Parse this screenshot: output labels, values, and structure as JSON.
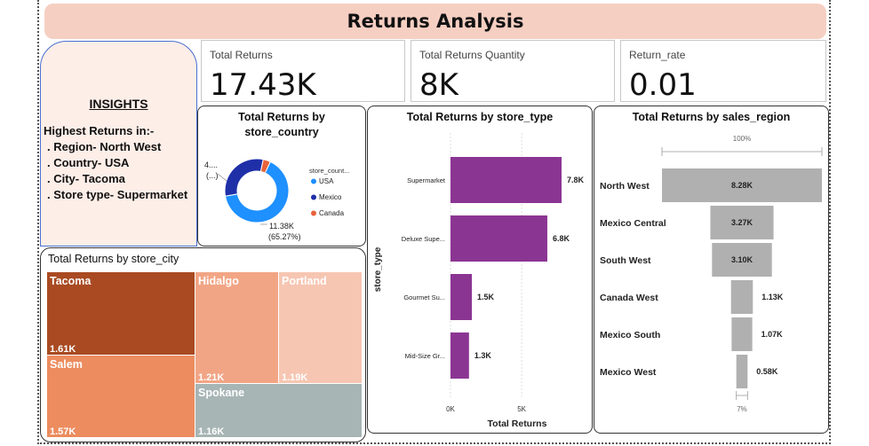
{
  "header": {
    "title": "Returns Analysis"
  },
  "kpis": [
    {
      "label": "Total Returns",
      "value": "17.43K"
    },
    {
      "label": "Total Returns Quantity",
      "value": "8K"
    },
    {
      "label": "Return_rate",
      "value": "0.01"
    }
  ],
  "insights": {
    "title": "INSIGHTS",
    "heading": "Highest Returns in:-",
    "lines": [
      ". Region- North West",
      ". Country- USA",
      ". City- Tacoma",
      ". Store type- Supermarket"
    ]
  },
  "colors": {
    "title_bar": "#f5cfc2",
    "usa": "#1e90ff",
    "mexico": "#1f2fa8",
    "canada": "#e8623a",
    "bar": "#8b3593",
    "funnel": "#b0b0b0"
  },
  "chart_data": [
    {
      "type": "pie",
      "title": "Total Returns by store_country",
      "legend_title": "store_count...",
      "legend_position": "right",
      "categories": [
        "USA",
        "Mexico",
        "Canada"
      ],
      "values": [
        11.38,
        5.4,
        0.65
      ],
      "data_labels": [
        "11.38K (65.27%)",
        "4.... (...)"
      ]
    },
    {
      "type": "heatmap",
      "title": "Total Returns by store_city",
      "categories": [
        "Tacoma",
        "Salem",
        "Hidalgo",
        "Portland",
        "Spokane"
      ],
      "values": [
        1.61,
        1.57,
        1.21,
        1.19,
        1.16
      ],
      "value_labels": [
        "1.61K",
        "1.57K",
        "1.21K",
        "1.19K",
        "1.16K"
      ]
    },
    {
      "type": "bar",
      "orientation": "horizontal",
      "title": "Total Returns by store_type",
      "xlabel": "Total Returns",
      "ylabel": "store_type",
      "categories": [
        "Supermarket",
        "Deluxe Supe...",
        "Gourmet Su...",
        "Mid-Size Gr..."
      ],
      "values": [
        7.8,
        6.8,
        1.5,
        1.3
      ],
      "value_labels": [
        "7.8K",
        "6.8K",
        "1.5K",
        "1.3K"
      ],
      "xlim": [
        0,
        8.4
      ],
      "x_ticks": [
        {
          "value": 0,
          "label": "0K"
        },
        {
          "value": 5,
          "label": "5K"
        }
      ],
      "grid": true
    },
    {
      "type": "bar",
      "subtype": "funnel",
      "title": "Total Returns by sales_region",
      "categories": [
        "North West",
        "Mexico Central",
        "South West",
        "Canada West",
        "Mexico South",
        "Mexico West"
      ],
      "values": [
        8.28,
        3.27,
        3.1,
        1.13,
        1.07,
        0.58
      ],
      "value_labels": [
        "8.28K",
        "3.27K",
        "3.10K",
        "1.13K",
        "1.07K",
        "0.58K"
      ],
      "top_percent_label": "100%",
      "bottom_percent_label": "7%"
    }
  ]
}
